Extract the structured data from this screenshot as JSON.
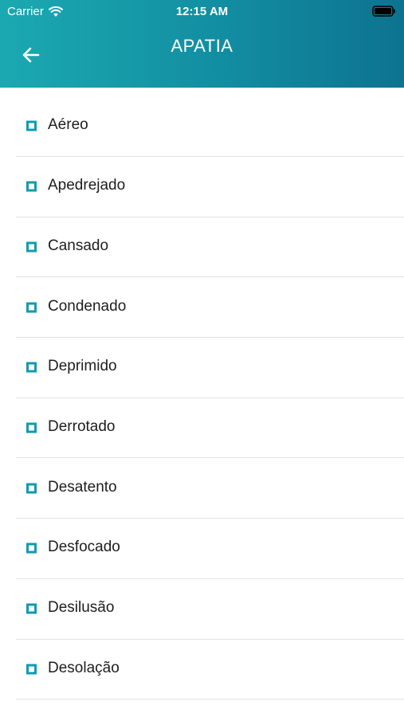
{
  "status_bar": {
    "carrier": "Carrier",
    "time": "12:15 AM",
    "wifi_icon": "wifi-icon",
    "battery_icon": "battery-icon"
  },
  "header": {
    "title": "APATIA",
    "back_icon": "arrow-left-icon",
    "gradient": [
      "#1ba9b1",
      "#0d7390"
    ]
  },
  "accent_color": "#129ab0",
  "list": {
    "items": [
      {
        "label": "Aéreo"
      },
      {
        "label": "Apedrejado"
      },
      {
        "label": "Cansado"
      },
      {
        "label": "Condenado"
      },
      {
        "label": "Deprimido"
      },
      {
        "label": "Derrotado"
      },
      {
        "label": "Desatento"
      },
      {
        "label": "Desfocado"
      },
      {
        "label": "Desilusão"
      },
      {
        "label": "Desolação"
      }
    ]
  }
}
